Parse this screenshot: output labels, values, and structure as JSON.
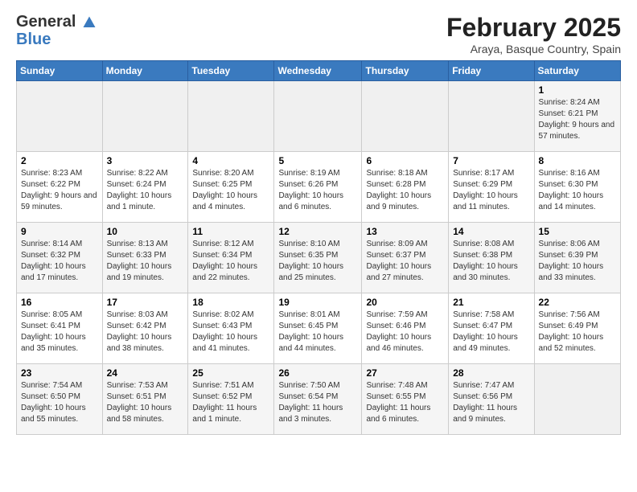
{
  "header": {
    "logo_general": "General",
    "logo_blue": "Blue",
    "month": "February 2025",
    "location": "Araya, Basque Country, Spain"
  },
  "weekdays": [
    "Sunday",
    "Monday",
    "Tuesday",
    "Wednesday",
    "Thursday",
    "Friday",
    "Saturday"
  ],
  "weeks": [
    [
      {
        "day": "",
        "info": ""
      },
      {
        "day": "",
        "info": ""
      },
      {
        "day": "",
        "info": ""
      },
      {
        "day": "",
        "info": ""
      },
      {
        "day": "",
        "info": ""
      },
      {
        "day": "",
        "info": ""
      },
      {
        "day": "1",
        "info": "Sunrise: 8:24 AM\nSunset: 6:21 PM\nDaylight: 9 hours and 57 minutes."
      }
    ],
    [
      {
        "day": "2",
        "info": "Sunrise: 8:23 AM\nSunset: 6:22 PM\nDaylight: 9 hours and 59 minutes."
      },
      {
        "day": "3",
        "info": "Sunrise: 8:22 AM\nSunset: 6:24 PM\nDaylight: 10 hours and 1 minute."
      },
      {
        "day": "4",
        "info": "Sunrise: 8:20 AM\nSunset: 6:25 PM\nDaylight: 10 hours and 4 minutes."
      },
      {
        "day": "5",
        "info": "Sunrise: 8:19 AM\nSunset: 6:26 PM\nDaylight: 10 hours and 6 minutes."
      },
      {
        "day": "6",
        "info": "Sunrise: 8:18 AM\nSunset: 6:28 PM\nDaylight: 10 hours and 9 minutes."
      },
      {
        "day": "7",
        "info": "Sunrise: 8:17 AM\nSunset: 6:29 PM\nDaylight: 10 hours and 11 minutes."
      },
      {
        "day": "8",
        "info": "Sunrise: 8:16 AM\nSunset: 6:30 PM\nDaylight: 10 hours and 14 minutes."
      }
    ],
    [
      {
        "day": "9",
        "info": "Sunrise: 8:14 AM\nSunset: 6:32 PM\nDaylight: 10 hours and 17 minutes."
      },
      {
        "day": "10",
        "info": "Sunrise: 8:13 AM\nSunset: 6:33 PM\nDaylight: 10 hours and 19 minutes."
      },
      {
        "day": "11",
        "info": "Sunrise: 8:12 AM\nSunset: 6:34 PM\nDaylight: 10 hours and 22 minutes."
      },
      {
        "day": "12",
        "info": "Sunrise: 8:10 AM\nSunset: 6:35 PM\nDaylight: 10 hours and 25 minutes."
      },
      {
        "day": "13",
        "info": "Sunrise: 8:09 AM\nSunset: 6:37 PM\nDaylight: 10 hours and 27 minutes."
      },
      {
        "day": "14",
        "info": "Sunrise: 8:08 AM\nSunset: 6:38 PM\nDaylight: 10 hours and 30 minutes."
      },
      {
        "day": "15",
        "info": "Sunrise: 8:06 AM\nSunset: 6:39 PM\nDaylight: 10 hours and 33 minutes."
      }
    ],
    [
      {
        "day": "16",
        "info": "Sunrise: 8:05 AM\nSunset: 6:41 PM\nDaylight: 10 hours and 35 minutes."
      },
      {
        "day": "17",
        "info": "Sunrise: 8:03 AM\nSunset: 6:42 PM\nDaylight: 10 hours and 38 minutes."
      },
      {
        "day": "18",
        "info": "Sunrise: 8:02 AM\nSunset: 6:43 PM\nDaylight: 10 hours and 41 minutes."
      },
      {
        "day": "19",
        "info": "Sunrise: 8:01 AM\nSunset: 6:45 PM\nDaylight: 10 hours and 44 minutes."
      },
      {
        "day": "20",
        "info": "Sunrise: 7:59 AM\nSunset: 6:46 PM\nDaylight: 10 hours and 46 minutes."
      },
      {
        "day": "21",
        "info": "Sunrise: 7:58 AM\nSunset: 6:47 PM\nDaylight: 10 hours and 49 minutes."
      },
      {
        "day": "22",
        "info": "Sunrise: 7:56 AM\nSunset: 6:49 PM\nDaylight: 10 hours and 52 minutes."
      }
    ],
    [
      {
        "day": "23",
        "info": "Sunrise: 7:54 AM\nSunset: 6:50 PM\nDaylight: 10 hours and 55 minutes."
      },
      {
        "day": "24",
        "info": "Sunrise: 7:53 AM\nSunset: 6:51 PM\nDaylight: 10 hours and 58 minutes."
      },
      {
        "day": "25",
        "info": "Sunrise: 7:51 AM\nSunset: 6:52 PM\nDaylight: 11 hours and 1 minute."
      },
      {
        "day": "26",
        "info": "Sunrise: 7:50 AM\nSunset: 6:54 PM\nDaylight: 11 hours and 3 minutes."
      },
      {
        "day": "27",
        "info": "Sunrise: 7:48 AM\nSunset: 6:55 PM\nDaylight: 11 hours and 6 minutes."
      },
      {
        "day": "28",
        "info": "Sunrise: 7:47 AM\nSunset: 6:56 PM\nDaylight: 11 hours and 9 minutes."
      },
      {
        "day": "",
        "info": ""
      }
    ]
  ]
}
